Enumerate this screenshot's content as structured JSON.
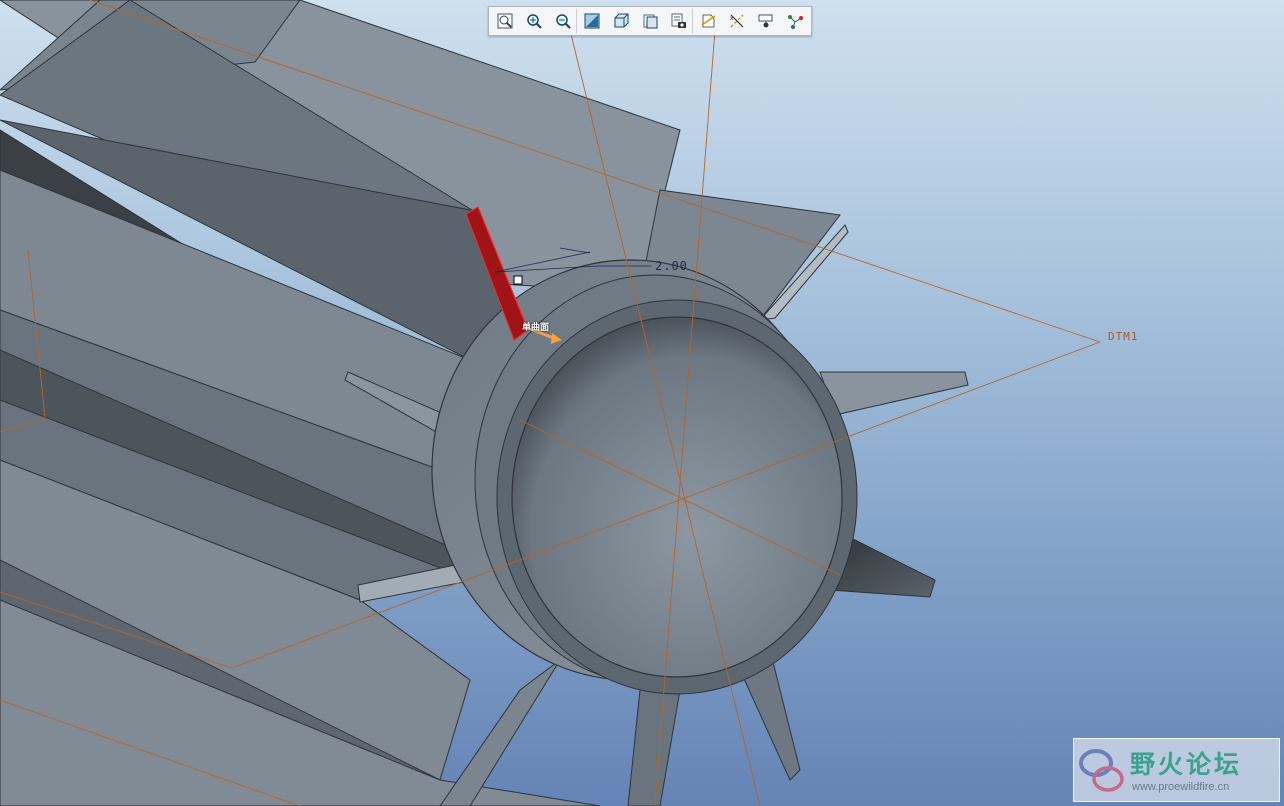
{
  "toolbar": {
    "buttons": [
      {
        "name": "refit-button",
        "icon": "zoom-fit-icon",
        "tooltip": ""
      },
      {
        "name": "zoom-in-button",
        "icon": "zoom-in-icon",
        "tooltip": ""
      },
      {
        "name": "zoom-out-button",
        "icon": "zoom-out-icon",
        "tooltip": ""
      },
      {
        "name": "reorient-button",
        "icon": "reorient-icon",
        "tooltip": ""
      },
      {
        "name": "saved-views-button",
        "icon": "saved-views-icon",
        "tooltip": ""
      },
      {
        "name": "display-style-button",
        "icon": "display-style-icon",
        "tooltip": ""
      },
      {
        "name": "view-manager-button",
        "icon": "view-manager-icon",
        "tooltip": ""
      },
      {
        "name": "datum-display-button",
        "icon": "datum-display-icon",
        "tooltip": ""
      },
      {
        "name": "axis-display-button",
        "icon": "axis-display-icon",
        "tooltip": ""
      },
      {
        "name": "annotation-display-button",
        "icon": "annotation-display-icon",
        "tooltip": ""
      },
      {
        "name": "spin-center-button",
        "icon": "spin-center-icon",
        "tooltip": ""
      }
    ]
  },
  "viewport": {
    "datum_plane_label": "DTM1",
    "dimension_value": "2.00",
    "selection_label": "单曲面",
    "colors": {
      "background_top": "#cfe0ee",
      "background_bottom": "#6583b5",
      "model": "#7e8a95",
      "highlight": "#b3161a",
      "datum": "#b5652c"
    }
  },
  "watermark": {
    "title": "野火论坛",
    "url": "www.proewildfire.cn"
  }
}
